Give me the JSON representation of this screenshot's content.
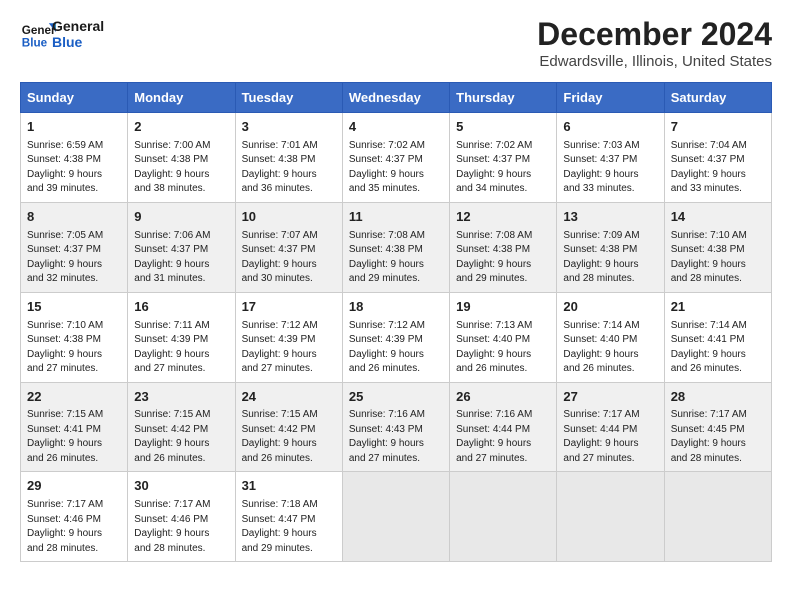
{
  "logo": {
    "line1": "General",
    "line2": "Blue"
  },
  "title": "December 2024",
  "subtitle": "Edwardsville, Illinois, United States",
  "days_of_week": [
    "Sunday",
    "Monday",
    "Tuesday",
    "Wednesday",
    "Thursday",
    "Friday",
    "Saturday"
  ],
  "weeks": [
    [
      {
        "day": "1",
        "sunrise": "6:59 AM",
        "sunset": "4:38 PM",
        "daylight": "9 hours and 39 minutes."
      },
      {
        "day": "2",
        "sunrise": "7:00 AM",
        "sunset": "4:38 PM",
        "daylight": "9 hours and 38 minutes."
      },
      {
        "day": "3",
        "sunrise": "7:01 AM",
        "sunset": "4:38 PM",
        "daylight": "9 hours and 36 minutes."
      },
      {
        "day": "4",
        "sunrise": "7:02 AM",
        "sunset": "4:37 PM",
        "daylight": "9 hours and 35 minutes."
      },
      {
        "day": "5",
        "sunrise": "7:02 AM",
        "sunset": "4:37 PM",
        "daylight": "9 hours and 34 minutes."
      },
      {
        "day": "6",
        "sunrise": "7:03 AM",
        "sunset": "4:37 PM",
        "daylight": "9 hours and 33 minutes."
      },
      {
        "day": "7",
        "sunrise": "7:04 AM",
        "sunset": "4:37 PM",
        "daylight": "9 hours and 33 minutes."
      }
    ],
    [
      {
        "day": "8",
        "sunrise": "7:05 AM",
        "sunset": "4:37 PM",
        "daylight": "9 hours and 32 minutes."
      },
      {
        "day": "9",
        "sunrise": "7:06 AM",
        "sunset": "4:37 PM",
        "daylight": "9 hours and 31 minutes."
      },
      {
        "day": "10",
        "sunrise": "7:07 AM",
        "sunset": "4:37 PM",
        "daylight": "9 hours and 30 minutes."
      },
      {
        "day": "11",
        "sunrise": "7:08 AM",
        "sunset": "4:38 PM",
        "daylight": "9 hours and 29 minutes."
      },
      {
        "day": "12",
        "sunrise": "7:08 AM",
        "sunset": "4:38 PM",
        "daylight": "9 hours and 29 minutes."
      },
      {
        "day": "13",
        "sunrise": "7:09 AM",
        "sunset": "4:38 PM",
        "daylight": "9 hours and 28 minutes."
      },
      {
        "day": "14",
        "sunrise": "7:10 AM",
        "sunset": "4:38 PM",
        "daylight": "9 hours and 28 minutes."
      }
    ],
    [
      {
        "day": "15",
        "sunrise": "7:10 AM",
        "sunset": "4:38 PM",
        "daylight": "9 hours and 27 minutes."
      },
      {
        "day": "16",
        "sunrise": "7:11 AM",
        "sunset": "4:39 PM",
        "daylight": "9 hours and 27 minutes."
      },
      {
        "day": "17",
        "sunrise": "7:12 AM",
        "sunset": "4:39 PM",
        "daylight": "9 hours and 27 minutes."
      },
      {
        "day": "18",
        "sunrise": "7:12 AM",
        "sunset": "4:39 PM",
        "daylight": "9 hours and 26 minutes."
      },
      {
        "day": "19",
        "sunrise": "7:13 AM",
        "sunset": "4:40 PM",
        "daylight": "9 hours and 26 minutes."
      },
      {
        "day": "20",
        "sunrise": "7:14 AM",
        "sunset": "4:40 PM",
        "daylight": "9 hours and 26 minutes."
      },
      {
        "day": "21",
        "sunrise": "7:14 AM",
        "sunset": "4:41 PM",
        "daylight": "9 hours and 26 minutes."
      }
    ],
    [
      {
        "day": "22",
        "sunrise": "7:15 AM",
        "sunset": "4:41 PM",
        "daylight": "9 hours and 26 minutes."
      },
      {
        "day": "23",
        "sunrise": "7:15 AM",
        "sunset": "4:42 PM",
        "daylight": "9 hours and 26 minutes."
      },
      {
        "day": "24",
        "sunrise": "7:15 AM",
        "sunset": "4:42 PM",
        "daylight": "9 hours and 26 minutes."
      },
      {
        "day": "25",
        "sunrise": "7:16 AM",
        "sunset": "4:43 PM",
        "daylight": "9 hours and 27 minutes."
      },
      {
        "day": "26",
        "sunrise": "7:16 AM",
        "sunset": "4:44 PM",
        "daylight": "9 hours and 27 minutes."
      },
      {
        "day": "27",
        "sunrise": "7:17 AM",
        "sunset": "4:44 PM",
        "daylight": "9 hours and 27 minutes."
      },
      {
        "day": "28",
        "sunrise": "7:17 AM",
        "sunset": "4:45 PM",
        "daylight": "9 hours and 28 minutes."
      }
    ],
    [
      {
        "day": "29",
        "sunrise": "7:17 AM",
        "sunset": "4:46 PM",
        "daylight": "9 hours and 28 minutes."
      },
      {
        "day": "30",
        "sunrise": "7:17 AM",
        "sunset": "4:46 PM",
        "daylight": "9 hours and 28 minutes."
      },
      {
        "day": "31",
        "sunrise": "7:18 AM",
        "sunset": "4:47 PM",
        "daylight": "9 hours and 29 minutes."
      },
      null,
      null,
      null,
      null
    ]
  ],
  "labels": {
    "sunrise": "Sunrise:",
    "sunset": "Sunset:",
    "daylight": "Daylight:"
  }
}
